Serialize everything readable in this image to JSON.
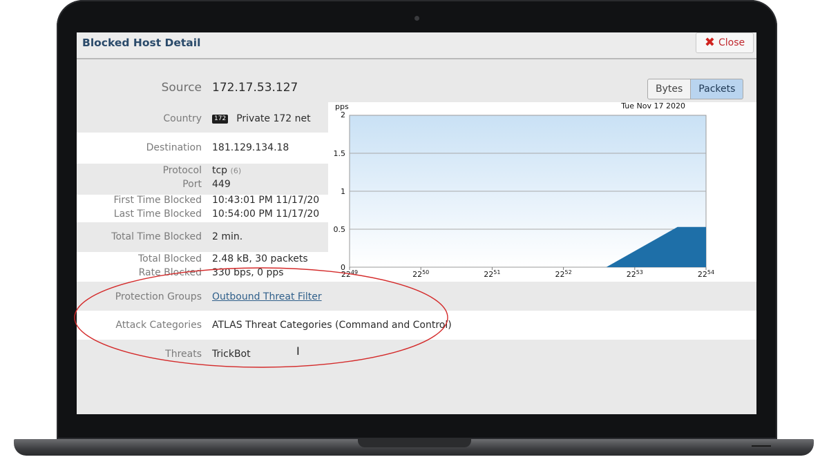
{
  "window": {
    "title": "Blocked Host Detail",
    "close_label": "Close"
  },
  "details": {
    "source_label": "Source",
    "source_value": "172.17.53.127",
    "country_label": "Country",
    "country_flag": "172",
    "country_value": "Private 172 net",
    "destination_label": "Destination",
    "destination_value": "181.129.134.18",
    "protocol_label": "Protocol",
    "protocol_value": "tcp",
    "protocol_number": "(6)",
    "port_label": "Port",
    "port_value": "449",
    "first_blocked_label": "First Time Blocked",
    "first_blocked_value": "10:43:01 PM 11/17/20",
    "last_blocked_label": "Last Time Blocked",
    "last_blocked_value": "10:54:00 PM 11/17/20",
    "total_time_label": "Total Time Blocked",
    "total_time_value": "2 min.",
    "total_blocked_label": "Total Blocked",
    "total_blocked_value": "2.48 kB, 30 packets",
    "rate_label": "Rate Blocked",
    "rate_value": "330 bps, 0 pps",
    "protection_label": "Protection Groups",
    "protection_value": "Outbound Threat Filter",
    "attack_label": "Attack Categories",
    "attack_value": "ATLAS Threat Categories (Command and Control)",
    "threats_label": "Threats",
    "threats_value": "TrickBot"
  },
  "toggle": {
    "bytes_label": "Bytes",
    "packets_label": "Packets",
    "selected": "Packets"
  },
  "colors": {
    "accent": "#1e6fa8",
    "title": "#2a4a6a",
    "annotation": "#d42a2a",
    "selected_toggle": "#b9d4ef"
  },
  "chart_data": {
    "type": "area",
    "title": "",
    "date": "Tue Nov 17 2020",
    "ylabel": "pps",
    "ylim": [
      0,
      2
    ],
    "yticks": [
      "0",
      "0.5",
      "1",
      "1.5",
      "2"
    ],
    "xticks": [
      {
        "h": "22",
        "m": "49"
      },
      {
        "h": "22",
        "m": "50"
      },
      {
        "h": "22",
        "m": "51"
      },
      {
        "h": "22",
        "m": "52"
      },
      {
        "h": "22",
        "m": "53"
      },
      {
        "h": "22",
        "m": "54"
      }
    ],
    "series": [
      {
        "x": [
          22.49,
          22.526,
          22.536,
          22.54
        ],
        "y": [
          0,
          0,
          0.53,
          0.53
        ]
      }
    ]
  }
}
